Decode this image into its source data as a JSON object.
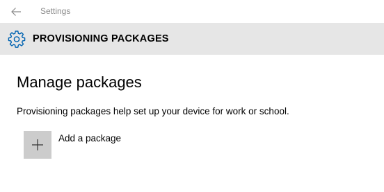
{
  "window": {
    "title": "Settings",
    "back_icon": "arrow-left-icon"
  },
  "header": {
    "icon": "gear-icon",
    "title": "PROVISIONING PACKAGES",
    "background": "#e6e6e6",
    "accent": "#0063b1"
  },
  "main": {
    "section_title": "Manage packages",
    "description": "Provisioning packages help set up your device for work or school.",
    "add_package": {
      "icon": "plus-icon",
      "label": "Add a package",
      "tile_color": "#cccccc"
    }
  }
}
